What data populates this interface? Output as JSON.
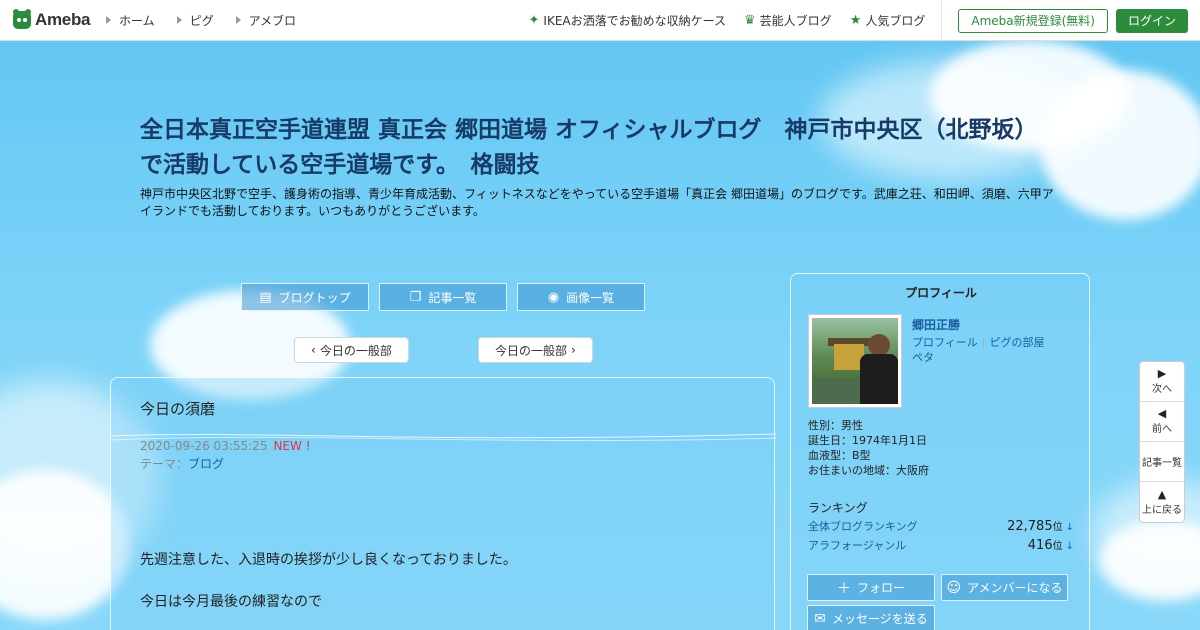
{
  "header": {
    "logo_text": "Ameba",
    "nav": [
      "ホーム",
      "ピグ",
      "アメブロ"
    ],
    "promos": [
      {
        "icon": "leaf-icon",
        "label": "IKEAお洒落でお勧めな収納ケース"
      },
      {
        "icon": "crown-icon",
        "label": "芸能人ブログ"
      },
      {
        "icon": "star-icon",
        "label": "人気ブログ"
      }
    ],
    "register_label": "Ameba新規登録(無料)",
    "login_label": "ログイン"
  },
  "blog": {
    "title": "全日本真正空手道連盟 真正会 郷田道場 オフィシャルブログ　神戸市中央区（北野坂）で活動している空手道場です。　格闘技",
    "description": "神戸市中央区北野で空手、護身術の指導、青少年育成活動、フィットネスなどをやっている空手道場「真正会 郷田道場」のブログです。武庫之荘、和田岬、須磨、六甲アイランドでも活動しております。いつもありがとうございます。",
    "nav": {
      "top": "ブログトップ",
      "list": "記事一覧",
      "images": "画像一覧"
    }
  },
  "pager": {
    "prev": "今日の一般部",
    "next": "今日の一般部"
  },
  "article": {
    "title": "今日の須磨",
    "date": "2020-09-26 03:55:25",
    "new_label": "NEW !",
    "theme_label": "テーマ：",
    "theme": "ブログ",
    "body": [
      "先週注意した、入退時の挨拶が少し良くなっておりました。",
      "今日は今月最後の練習なので"
    ]
  },
  "profile": {
    "heading": "プロフィール",
    "name": "郷田正勝",
    "link_profile": "プロフィール",
    "link_room": "ピグの部屋",
    "link_peta": "ペタ",
    "info": [
      "性別：男性",
      "誕生日：1974年1月1日",
      "血液型：B型",
      "お住まいの地域：大阪府"
    ],
    "ranking_label": "ランキング",
    "rankings": [
      {
        "label": "全体ブログランキング",
        "value": "22,785",
        "unit": "位",
        "arrow": "↓"
      },
      {
        "label": "アラフォージャンル",
        "value": "416",
        "unit": "位",
        "arrow": "↓"
      }
    ],
    "follow": "フォロー",
    "member": "アメンバーになる",
    "message": "メッセージを送る"
  },
  "sidenav": {
    "next": "次へ",
    "prev": "前へ",
    "list": "記事一覧",
    "top": "上に戻る"
  },
  "colors": {
    "brand": "#2d8c3c",
    "link": "#1a5fa0",
    "new": "#e0334a",
    "title": "#173a66"
  }
}
